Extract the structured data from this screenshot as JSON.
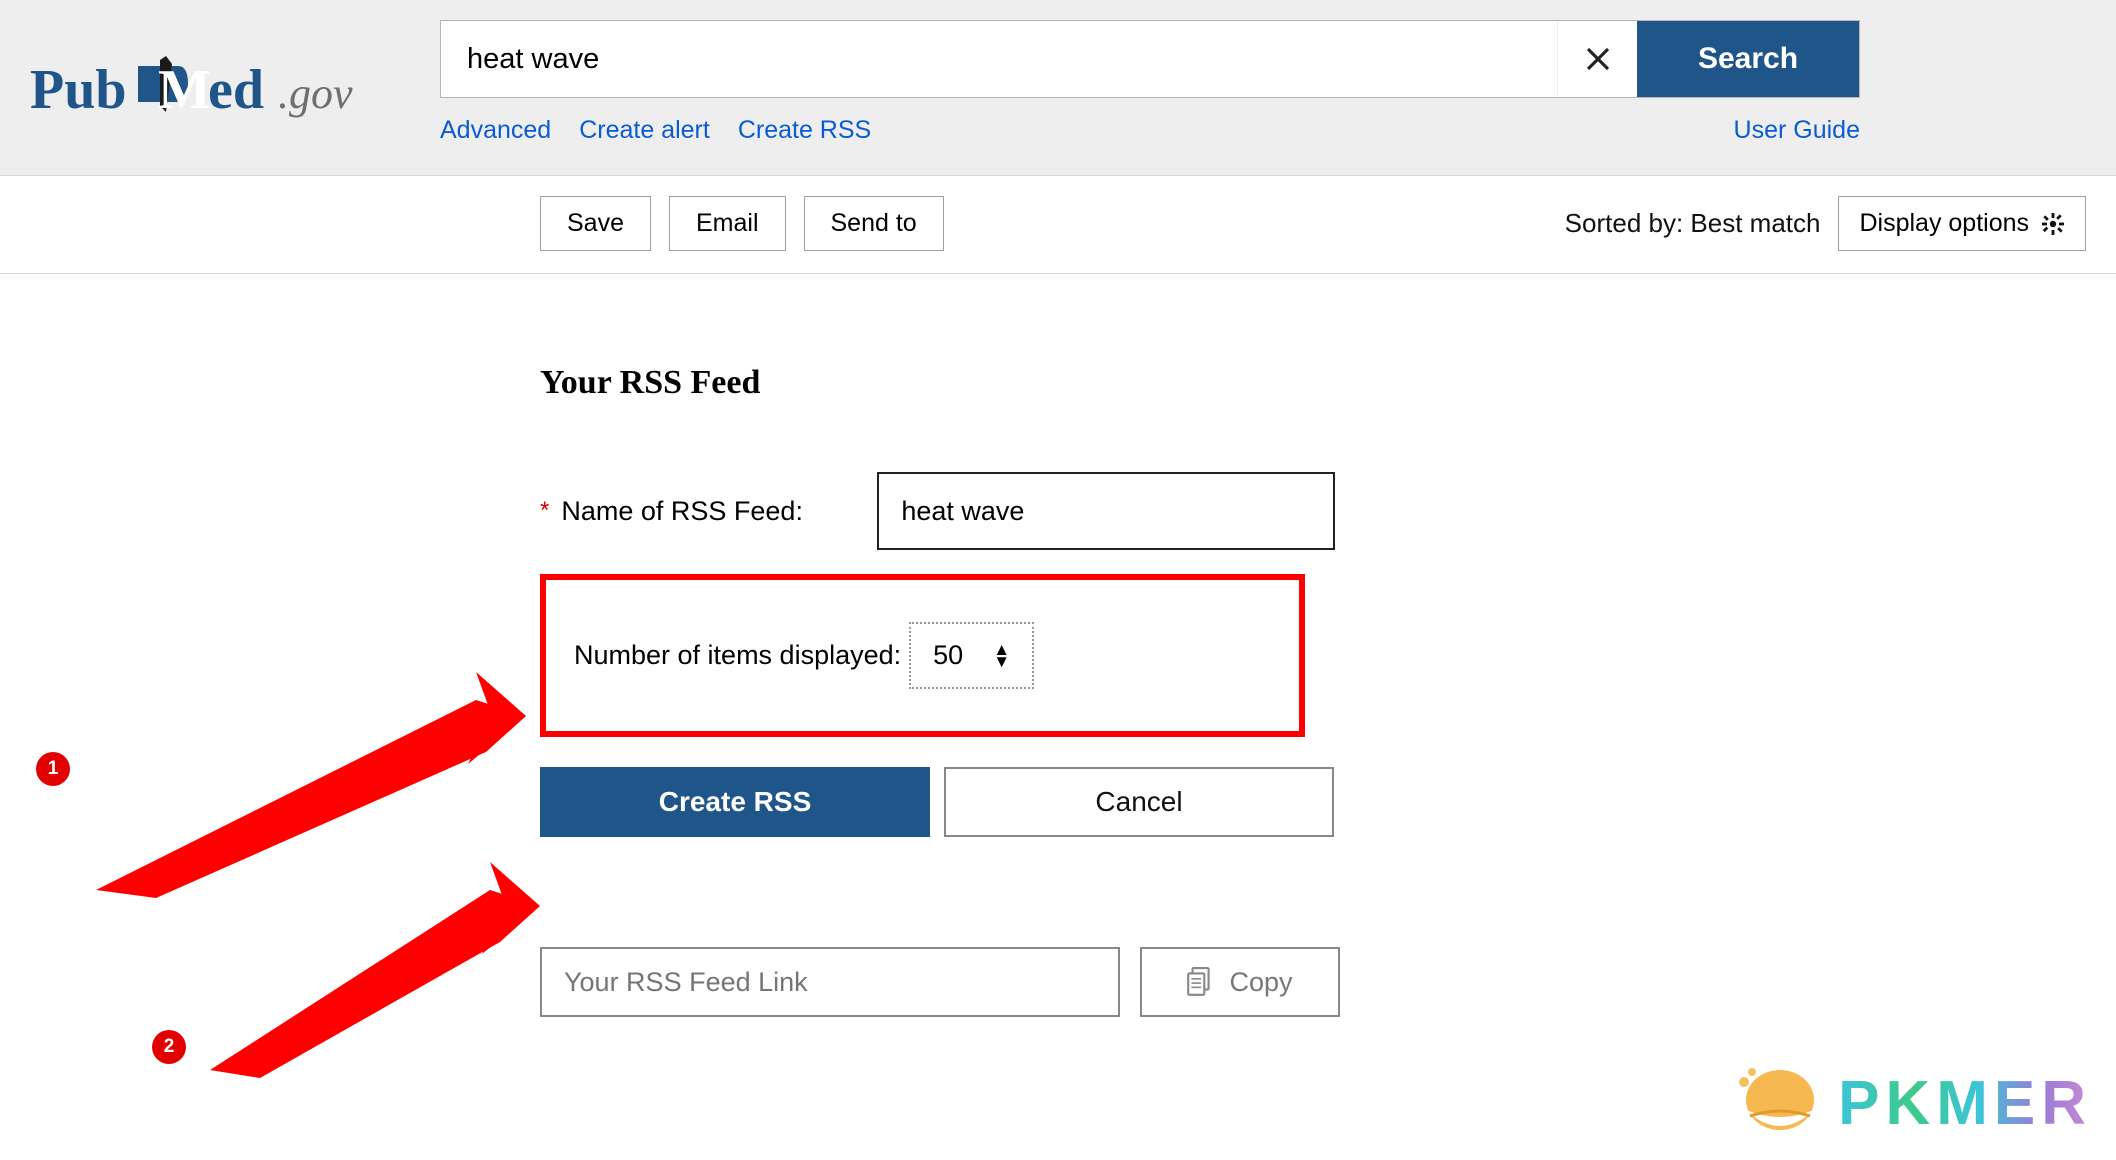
{
  "search": {
    "value": "heat wave",
    "button": "Search"
  },
  "links": {
    "advanced": "Advanced",
    "create_alert": "Create alert",
    "create_rss": "Create RSS",
    "user_guide": "User Guide"
  },
  "toolbar": {
    "save": "Save",
    "email": "Email",
    "send_to": "Send to",
    "sorted_by": "Sorted by: Best match",
    "display_options": "Display options"
  },
  "rss": {
    "title": "Your RSS Feed",
    "name_label": "Name of RSS Feed:",
    "name_value": "heat wave",
    "items_label": "Number of items displayed:",
    "items_value": "50",
    "create_btn": "Create RSS",
    "cancel_btn": "Cancel",
    "link_placeholder": "Your RSS Feed Link",
    "copy_btn": "Copy"
  },
  "annotations": {
    "badge1": "1",
    "badge2": "2"
  },
  "watermark": "PKMER"
}
